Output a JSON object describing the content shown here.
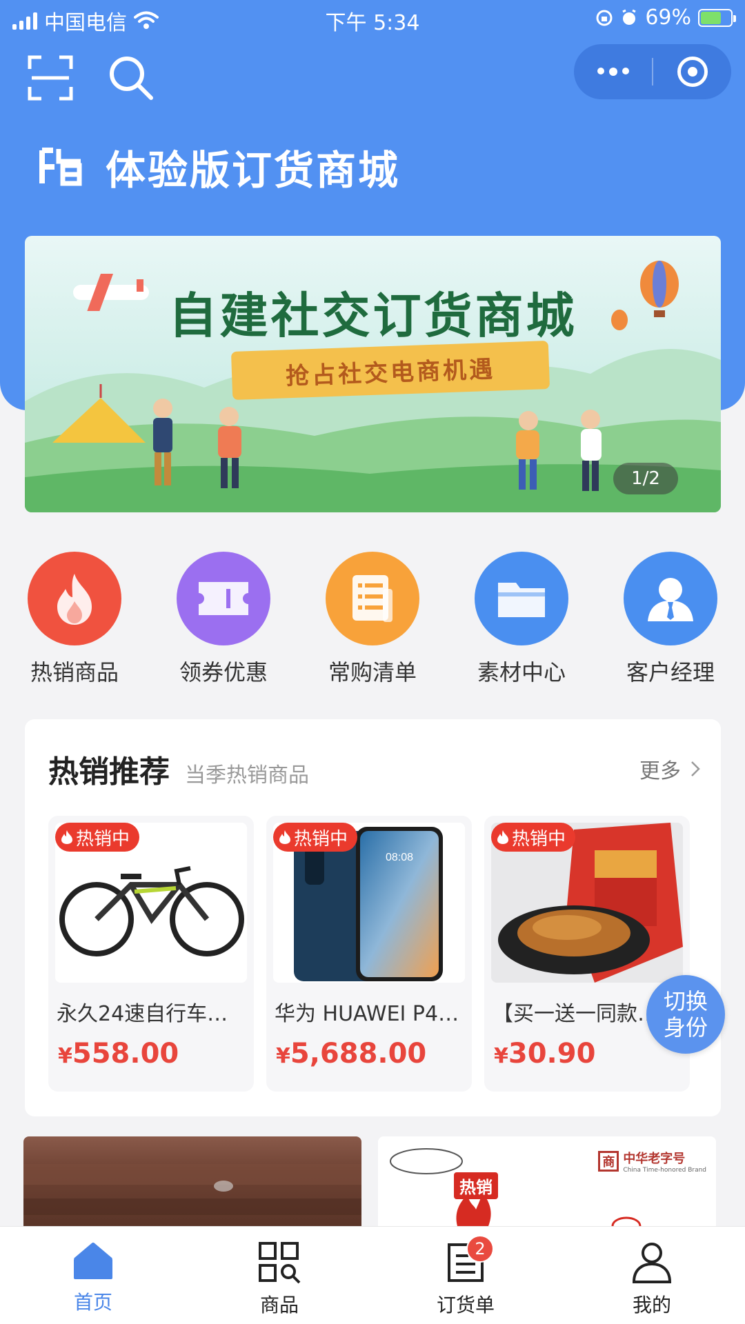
{
  "status_bar": {
    "carrier": "中国电信",
    "time": "下午 5:34",
    "battery_percent": "69%",
    "battery_level": 0.69,
    "icons": [
      "signal-icon",
      "wifi-icon",
      "lock-rotation-icon",
      "alarm-icon",
      "battery-icon"
    ]
  },
  "header": {
    "scan_icon": "scan-icon",
    "search_icon": "search-icon",
    "capsule": {
      "more_icon": "more-dots-icon",
      "close_icon": "target-icon"
    },
    "store_name": "体验版订货商城",
    "background_color": "#5291f2"
  },
  "banner": {
    "title": "自建社交订货商城",
    "ribbon_text": "抢占社交电商机遇",
    "page_indicator": "1/2"
  },
  "quick_menu": [
    {
      "label": "热销商品",
      "icon": "flame-icon",
      "color": "#f0523f"
    },
    {
      "label": "领券优惠",
      "icon": "coupon-icon",
      "color": "#9b6ff0"
    },
    {
      "label": "常购清单",
      "icon": "list-icon",
      "color": "#f8a23a"
    },
    {
      "label": "素材中心",
      "icon": "folder-icon",
      "color": "#4a8ff0"
    },
    {
      "label": "客户经理",
      "icon": "manager-icon",
      "color": "#4a8ff0"
    }
  ],
  "hot_section": {
    "title": "热销推荐",
    "subtitle": "当季热销商品",
    "more_label": "更多",
    "products": [
      {
        "tag": "热销中",
        "name": "永久24速自行车…",
        "currency": "¥",
        "price": "558.00"
      },
      {
        "tag": "热销中",
        "name": "华为 HUAWEI P4…",
        "currency": "¥",
        "price": "5,688.00"
      },
      {
        "tag": "热销中",
        "name": "【买一送一同款…",
        "currency": "¥",
        "price": "30.90"
      }
    ]
  },
  "switch_button": {
    "line1": "切换",
    "line2": "身份"
  },
  "promo": {
    "hot_label": "热销",
    "brand_cn": "中华老字号",
    "brand_en": "China Time-honored Brand",
    "brand_mark": "商"
  },
  "tabbar": {
    "tabs": [
      {
        "label": "首页",
        "icon": "home-icon",
        "active": true
      },
      {
        "label": "商品",
        "icon": "products-grid-icon",
        "active": false
      },
      {
        "label": "订货单",
        "icon": "order-icon",
        "active": false,
        "badge": "2"
      },
      {
        "label": "我的",
        "icon": "user-icon",
        "active": false
      }
    ],
    "active_color": "#4a86e8"
  }
}
